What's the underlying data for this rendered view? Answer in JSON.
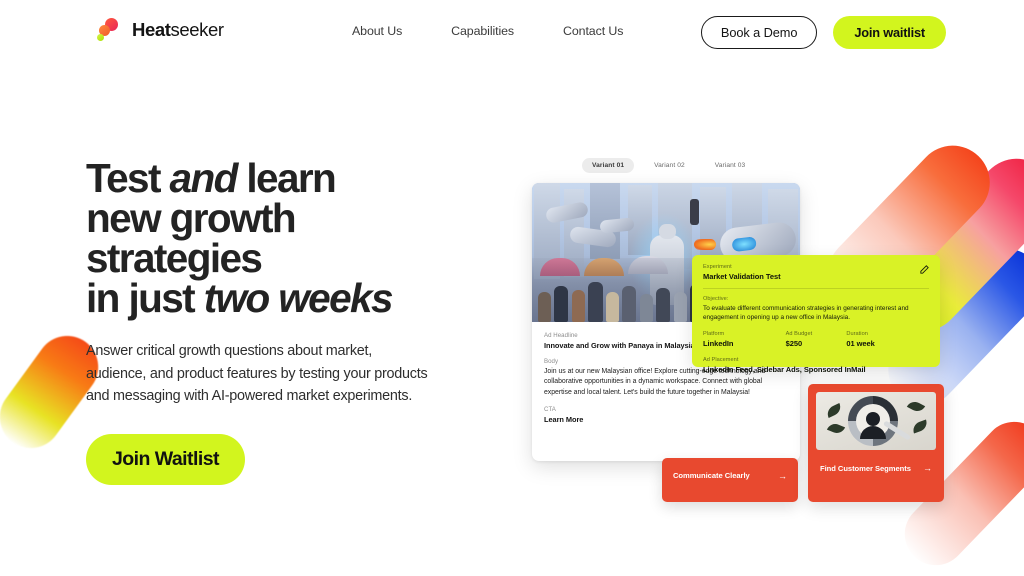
{
  "brand": {
    "name_bold": "Heat",
    "name_light": "seeker",
    "logo_icon": "heatseeker-dots-logo"
  },
  "nav": {
    "links": [
      {
        "label": "About Us"
      },
      {
        "label": "Capabilities"
      },
      {
        "label": "Contact Us"
      }
    ],
    "book_demo_label": "Book a Demo",
    "join_waitlist_label": "Join waitlist"
  },
  "hero": {
    "headline_line1_a": "Test ",
    "headline_line1_em": "and",
    "headline_line1_b": " learn",
    "headline_line2": "new growth",
    "headline_line3": "strategies",
    "headline_line4_a": "in just ",
    "headline_line4_em": "two weeks",
    "subcopy": "Answer critical growth questions about market, audience, and product features by testing your products and messaging with AI-powered market experiments.",
    "cta_label": "Join Waitlist"
  },
  "mockup": {
    "variants": [
      {
        "label": "Variant 01",
        "active": true
      },
      {
        "label": "Variant 02",
        "active": false
      },
      {
        "label": "Variant 03",
        "active": false
      }
    ],
    "ad_card": {
      "image_alt": "futuristic-city-crowd-robots-illustration",
      "headline_label": "Ad Headline",
      "headline_value": "Innovate and Grow with Panaya in Malaysia",
      "body_label": "Body",
      "body_value": "Join us at our new Malaysian office! Explore cutting-edge technology and collaborative opportunities in a dynamic workspace. Connect with global expertise and local talent. Let's build the future together in Malaysia!",
      "cta_label": "CTA",
      "cta_value": "Learn More"
    },
    "experiment_card": {
      "experiment_label": "Experiment",
      "experiment_value": "Market Validation Test",
      "objective_label": "Objective:",
      "objective_value": "To evaluate different communication strategies in generating interest and engagement in opening up a new office in Malaysia.",
      "platform_label": "Platform",
      "platform_value": "LinkedIn",
      "budget_label": "Ad Budget",
      "budget_value": "$250",
      "duration_label": "Duration",
      "duration_value": "01 week",
      "placement_label": "Ad Placement",
      "placement_value": "LinkedIn Feed, Sidebar Ads, Sponsored InMail",
      "edit_icon": "pencil-edit-icon"
    },
    "feature_cards": [
      {
        "title": "Communicate Clearly",
        "arrow": "→"
      },
      {
        "title": "Find Customer Segments",
        "arrow": "→",
        "image_alt": "customer-segments-magnifier-illustration"
      }
    ]
  },
  "colors": {
    "accent_lime": "#d2f51e",
    "experiment_card": "#d9f226",
    "feature_card_red": "#e8492f",
    "text_dark": "#232323",
    "page_background": "#ffffff"
  }
}
